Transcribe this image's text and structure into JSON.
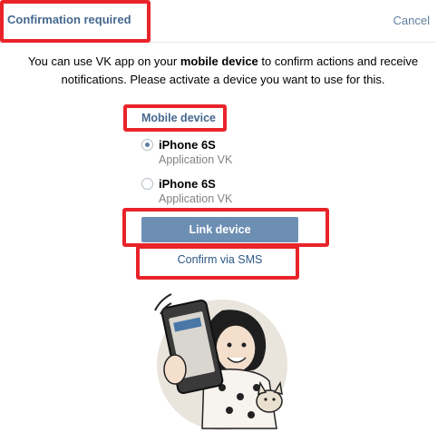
{
  "header": {
    "title": "Confirmation required",
    "cancel_label": "Cancel"
  },
  "intro": {
    "text_before": "You can use VK app on your ",
    "text_bold": "mobile device",
    "text_after": " to confirm actions and receive notifications. Please activate a device you want to use for this."
  },
  "section": {
    "label": "Mobile device"
  },
  "devices": [
    {
      "name": "iPhone 6S",
      "app": "Application VK",
      "selected": true
    },
    {
      "name": "iPhone 6S",
      "app": "Application VK",
      "selected": false
    }
  ],
  "actions": {
    "link_label": "Link device",
    "sms_label": "Confirm via SMS"
  },
  "colors": {
    "accent": "#45688e",
    "button": "#6d8fb3",
    "highlight": "#e8242a"
  },
  "illustration": {
    "name": "vk-mascot-phone-illustration"
  }
}
